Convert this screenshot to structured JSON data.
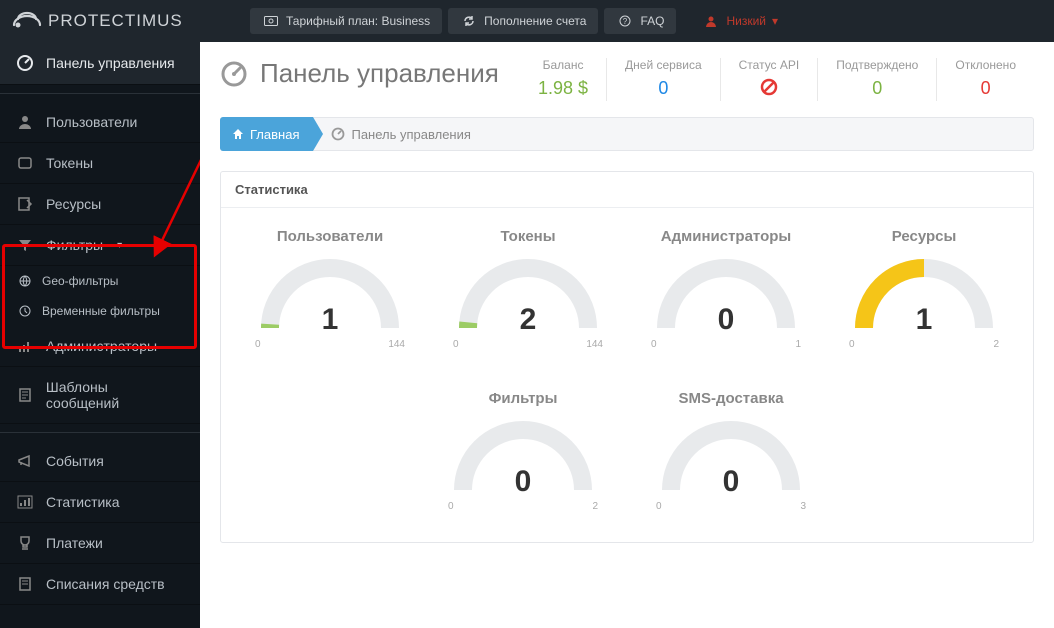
{
  "brand": "PROTECTIMUS",
  "topbar": {
    "plan_label": "Тарифный план: Business",
    "topup_label": "Пополнение счета",
    "faq_label": "FAQ",
    "user_label": "Низкий"
  },
  "sidebar": {
    "dashboard": "Панель управления",
    "users": "Пользователи",
    "tokens": "Токены",
    "resources": "Ресурсы",
    "filters": "Фильтры",
    "geo_filters": "Geo-фильтры",
    "time_filters": "Временные фильтры",
    "admins": "Администраторы",
    "templates": "Шаблоны сообщений",
    "events": "События",
    "stats": "Статистика",
    "payments": "Платежи",
    "writeoffs": "Списания средств"
  },
  "page": {
    "title": "Панель управления",
    "breadcrumb_home": "Главная",
    "breadcrumb_current": "Панель управления",
    "statbar": {
      "balance_lbl": "Баланс",
      "balance_val": "1.98 $",
      "days_lbl": "Дней сервиса",
      "days_val": "0",
      "api_lbl": "Статус API",
      "confirmed_lbl": "Подтверждено",
      "confirmed_val": "0",
      "rejected_lbl": "Отклонено",
      "rejected_val": "0"
    }
  },
  "card_title": "Статистика",
  "chart_data": [
    {
      "type": "gauge",
      "title": "Пользователи",
      "value": 1,
      "min": 0,
      "max": 144,
      "fill_ratio": 0.02,
      "color": "#9ccc65"
    },
    {
      "type": "gauge",
      "title": "Токены",
      "value": 2,
      "min": 0,
      "max": 144,
      "fill_ratio": 0.03,
      "color": "#9ccc65"
    },
    {
      "type": "gauge",
      "title": "Администраторы",
      "value": 0,
      "min": 0,
      "max": 1,
      "fill_ratio": 0.0,
      "color": "#9ccc65"
    },
    {
      "type": "gauge",
      "title": "Ресурсы",
      "value": 1,
      "min": 0,
      "max": 2,
      "fill_ratio": 0.5,
      "color": "#f5c518"
    },
    {
      "type": "gauge",
      "title": "Фильтры",
      "value": 0,
      "min": 0,
      "max": 2,
      "fill_ratio": 0.0,
      "color": "#9ccc65"
    },
    {
      "type": "gauge",
      "title": "SMS-доставка",
      "value": 0,
      "min": 0,
      "max": 3,
      "fill_ratio": 0.0,
      "color": "#9ccc65"
    }
  ]
}
